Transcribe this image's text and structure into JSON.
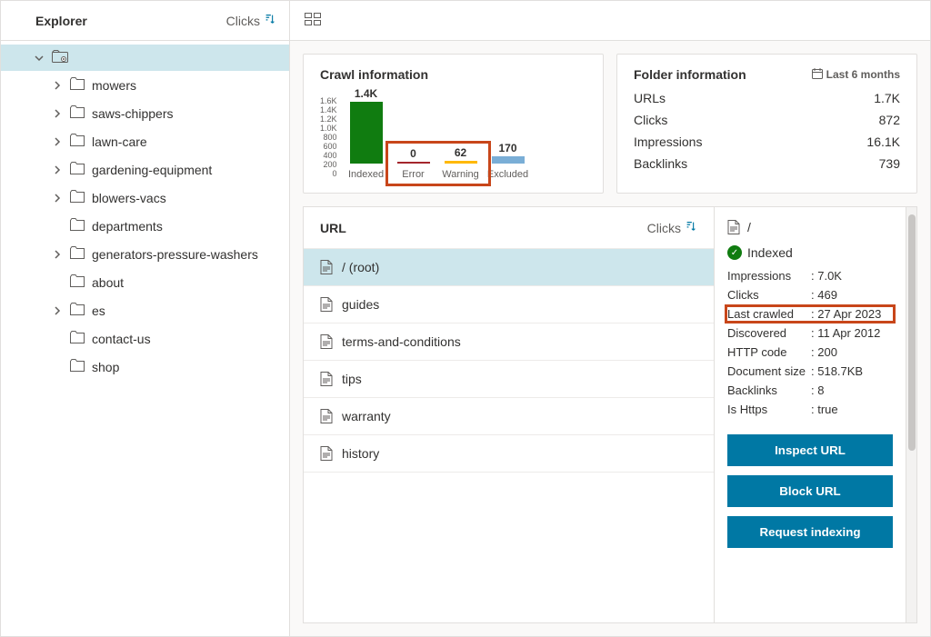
{
  "sidebar": {
    "title": "Explorer",
    "sort_label": "Clicks",
    "root_icon": "home-folder-icon",
    "items": [
      {
        "label": "mowers",
        "expandable": true
      },
      {
        "label": "saws-chippers",
        "expandable": true
      },
      {
        "label": "lawn-care",
        "expandable": true
      },
      {
        "label": "gardening-equipment",
        "expandable": true
      },
      {
        "label": "blowers-vacs",
        "expandable": true
      },
      {
        "label": "departments",
        "expandable": false
      },
      {
        "label": "generators-pressure-washers",
        "expandable": true
      },
      {
        "label": "about",
        "expandable": false
      },
      {
        "label": "es",
        "expandable": true
      },
      {
        "label": "contact-us",
        "expandable": false
      },
      {
        "label": "shop",
        "expandable": false
      }
    ]
  },
  "crawl": {
    "title": "Crawl information",
    "y_ticks": [
      "0",
      "200",
      "400",
      "600",
      "800",
      "1.0K",
      "1.2K",
      "1.4K",
      "1.6K"
    ]
  },
  "chart_data": {
    "type": "bar",
    "categories": [
      "Indexed",
      "Error",
      "Warning",
      "Excluded"
    ],
    "values": [
      1400,
      0,
      62,
      170
    ],
    "display_values": [
      "1.4K",
      "0",
      "62",
      "170"
    ],
    "colors": [
      "#107c10",
      "#a4262c",
      "#ffb900",
      "#7aaed6"
    ],
    "title": "Crawl information",
    "ylim": [
      0,
      1600
    ],
    "highlight_indices": [
      1,
      2
    ]
  },
  "folder": {
    "title": "Folder information",
    "period": "Last 6 months",
    "rows": [
      {
        "label": "URLs",
        "value": "1.7K"
      },
      {
        "label": "Clicks",
        "value": "872"
      },
      {
        "label": "Impressions",
        "value": "16.1K"
      },
      {
        "label": "Backlinks",
        "value": "739"
      }
    ]
  },
  "urls": {
    "header": "URL",
    "sort_label": "Clicks",
    "rows": [
      {
        "label": "/ (root)",
        "selected": true
      },
      {
        "label": "guides",
        "selected": false
      },
      {
        "label": "terms-and-conditions",
        "selected": false
      },
      {
        "label": "tips",
        "selected": false
      },
      {
        "label": "warranty",
        "selected": false
      },
      {
        "label": "history",
        "selected": false
      }
    ]
  },
  "detail": {
    "path": "/",
    "status": "Indexed",
    "rows": [
      {
        "k": "Impressions",
        "v": "7.0K",
        "hl": false
      },
      {
        "k": "Clicks",
        "v": "469",
        "hl": false
      },
      {
        "k": "Last crawled",
        "v": "27 Apr 2023",
        "hl": true
      },
      {
        "k": "Discovered",
        "v": "11 Apr 2012",
        "hl": false
      },
      {
        "k": "HTTP code",
        "v": "200",
        "hl": false
      },
      {
        "k": "Document size",
        "v": "518.7KB",
        "hl": false
      },
      {
        "k": "Backlinks",
        "v": "8",
        "hl": false
      },
      {
        "k": "Is Https",
        "v": "true",
        "hl": false
      }
    ],
    "actions": [
      "Inspect URL",
      "Block URL",
      "Request indexing"
    ]
  }
}
